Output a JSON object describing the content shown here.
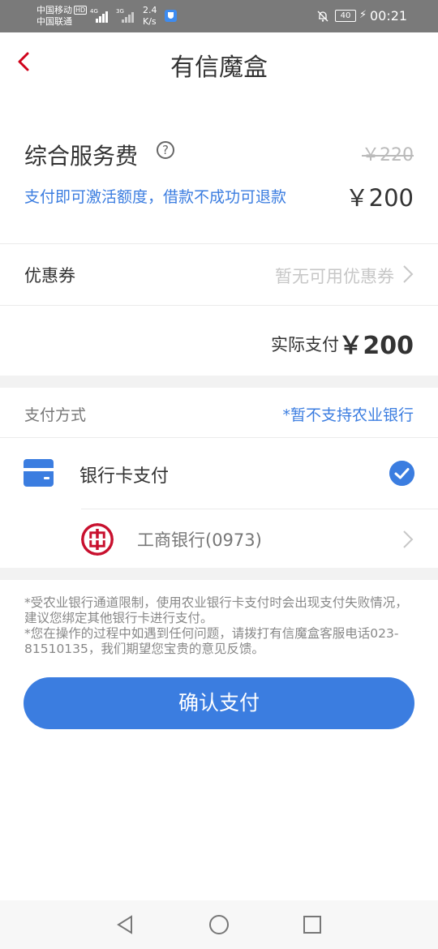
{
  "status_bar": {
    "carrier_1": "中国移动",
    "carrier_2": "中国联通",
    "hd": "HD",
    "network_1": "4G",
    "network_2": "3G",
    "speed_value": "2.4",
    "speed_unit": "K/s",
    "battery": "40",
    "time": "00:21"
  },
  "header": {
    "title": "有信魔盒",
    "back_icon": "chevron-left-icon"
  },
  "fee": {
    "title": "综合服务费",
    "help_symbol": "?",
    "original_price": "￥220",
    "note": "支付即可激活额度，借款不成功可退款",
    "price": "￥200"
  },
  "coupon": {
    "label": "优惠券",
    "value": "暂无可用优惠券"
  },
  "actual": {
    "label": "实际支付",
    "amount": "￥200"
  },
  "payment": {
    "method_label": "支付方式",
    "method_note": "*暂不支持农业银行",
    "bankcard_label": "银行卡支付",
    "bankcard_selected": true,
    "bank_name": "工商银行(0973)"
  },
  "notice": {
    "line_1": "*受农业银行通道限制，使用农业银行卡支付时会出现支付失败情况，建议您绑定其他银行卡进行支付。",
    "line_2": "*您在操作的过程中如遇到任何问题，请拨打有信魔盒客服电话023-81510135，我们期望您宝贵的意见反馈。"
  },
  "confirm_label": "确认支付",
  "colors": {
    "accent": "#3b7de0",
    "back_arrow": "#d0021b",
    "icbc_red": "#c8102e"
  },
  "nav": {
    "back_icon": "triangle-back-icon",
    "home_icon": "circle-home-icon",
    "recent_icon": "square-recent-icon"
  }
}
